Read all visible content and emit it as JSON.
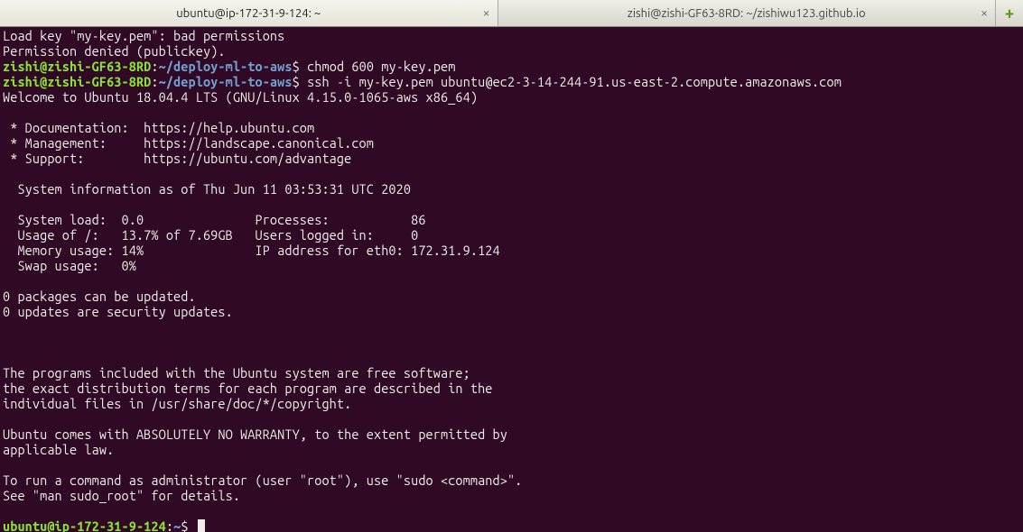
{
  "tabs": {
    "tab1": "ubuntu@ip-172-31-9-124: ~",
    "tab2": "zishi@zishi-GF63-8RD: ~/zishiwu123.github.io"
  },
  "term": {
    "line1": "Load key \"my-key.pem\": bad permissions",
    "line2": "Permission denied (publickey).",
    "prompt1_user": "zishi@zishi-GF63-8RD",
    "prompt1_path": "~/deploy-ml-to-aws",
    "cmd1": "chmod 600 my-key.pem",
    "prompt2_user": "zishi@zishi-GF63-8RD",
    "prompt2_path": "~/deploy-ml-to-aws",
    "cmd2": "ssh -i my-key.pem ubuntu@ec2-3-14-244-91.us-east-2.compute.amazonaws.com",
    "welcome": "Welcome to Ubuntu 18.04.4 LTS (GNU/Linux 4.15.0-1065-aws x86_64)",
    "doc": " * Documentation:  https://help.ubuntu.com",
    "mgmt": " * Management:     https://landscape.canonical.com",
    "supp": " * Support:        https://ubuntu.com/advantage",
    "sysinfo": "  System information as of Thu Jun 11 03:53:31 UTC 2020",
    "r1": "  System load:  0.0               Processes:           86",
    "r2": "  Usage of /:   13.7% of 7.69GB   Users logged in:     0",
    "r3": "  Memory usage: 14%               IP address for eth0: 172.31.9.124",
    "r4": "  Swap usage:   0%",
    "upd1": "0 packages can be updated.",
    "upd2": "0 updates are security updates.",
    "p1": "The programs included with the Ubuntu system are free software;",
    "p2": "the exact distribution terms for each program are described in the",
    "p3": "individual files in /usr/share/doc/*/copyright.",
    "p4": "Ubuntu comes with ABSOLUTELY NO WARRANTY, to the extent permitted by",
    "p5": "applicable law.",
    "p6": "To run a command as administrator (user \"root\"), use \"sudo <command>\".",
    "p7": "See \"man sudo_root\" for details.",
    "final_user": "ubuntu@ip-172-31-9-124",
    "final_path": "~",
    "dollar": "$"
  }
}
